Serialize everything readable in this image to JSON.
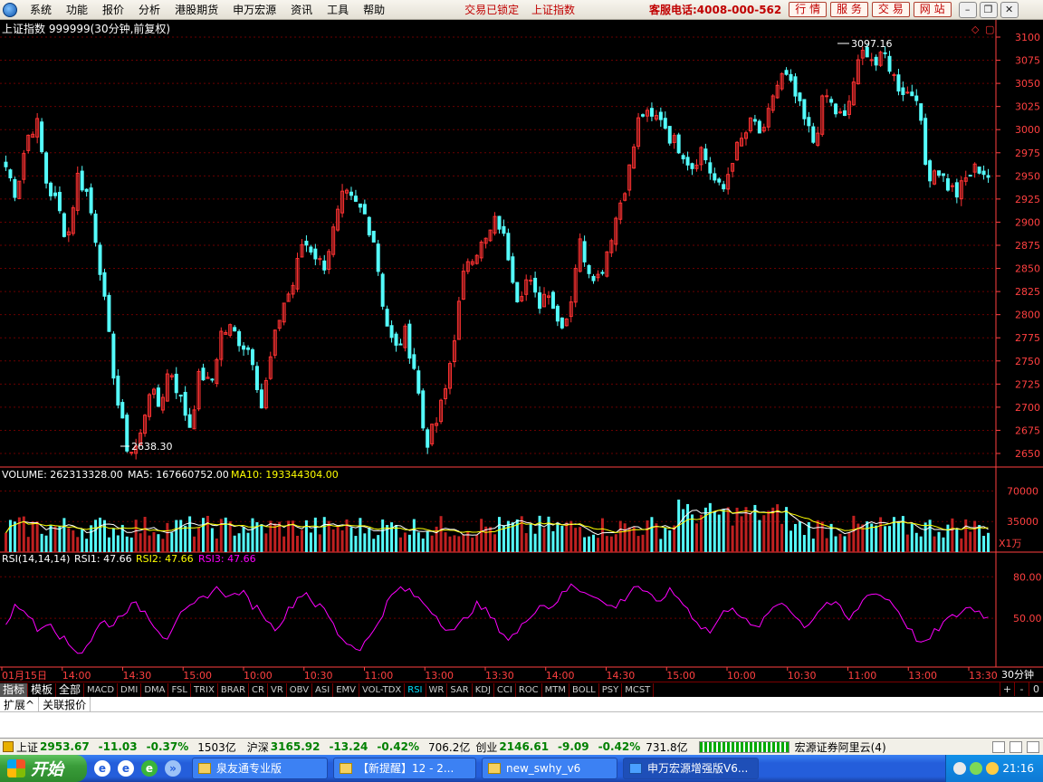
{
  "menu": {
    "items": [
      "系统",
      "功能",
      "报价",
      "分析",
      "港股期货",
      "申万宏源",
      "资讯",
      "工具",
      "帮助"
    ],
    "status": [
      "交易已锁定",
      "上证指数"
    ],
    "hotline": "客服电话:4008-000-562",
    "buttons": [
      "行 情",
      "服 务",
      "交 易",
      "网 站"
    ]
  },
  "chart": {
    "title": "上证指数 999999(30分钟,前复权)",
    "high_label": "3097.16",
    "low_label": "2638.30",
    "price_ticks": [
      "3100",
      "3075",
      "3050",
      "3025",
      "3000",
      "2975",
      "2950",
      "2925",
      "2900",
      "2875",
      "2850",
      "2825",
      "2800",
      "2775",
      "2750",
      "2725",
      "2700",
      "2675",
      "2650"
    ],
    "volume_header": {
      "volume": "VOLUME: 262313328.00",
      "ma5": "MA5: 167660752.00",
      "ma10": "MA10: 193344304.00"
    },
    "volume_ticks": [
      "70000",
      "35000"
    ],
    "volume_unit": "X1万",
    "rsi_header": {
      "label": "RSI(14,14,14)",
      "rsi1": "RSI1: 47.66",
      "rsi2": "RSI2: 47.66",
      "rsi3": "RSI3: 47.66"
    },
    "rsi_ticks": [
      "80.00",
      "50.00"
    ],
    "time_labels": [
      "01月15日",
      "14:00",
      "14:30",
      "15:00",
      "10:00",
      "10:30",
      "11:00",
      "13:00",
      "13:30",
      "14:00",
      "14:30",
      "15:00",
      "10:00",
      "10:30",
      "11:00",
      "13:00",
      "13:30"
    ],
    "period": "30分钟",
    "colors": {
      "up": "#ff3232",
      "down": "#54fcfc",
      "ma5": "#ffffff",
      "ma10": "#ffff00",
      "rsi": "#ff00ff",
      "axis": "#ff4040",
      "grid": "#6a0000"
    }
  },
  "chart_data": {
    "type": "candlestick",
    "title": "上证指数 999999(30分钟,前复权)",
    "high": 3097.16,
    "low": 2638.3,
    "ylim": [
      2630,
      3110
    ],
    "rsi_last": 47.66,
    "rsi_ylim": [
      20,
      90
    ],
    "volume_ylim": [
      0,
      85000
    ],
    "volume_unit": "X1万",
    "close_path": [
      2960,
      2930,
      2990,
      3010,
      2940,
      2920,
      2880,
      2950,
      2930,
      2870,
      2780,
      2700,
      2650,
      2660,
      2720,
      2700,
      2745,
      2710,
      2680,
      2740,
      2720,
      2780,
      2785,
      2770,
      2760,
      2700,
      2760,
      2810,
      2830,
      2880,
      2870,
      2850,
      2890,
      2930,
      2920,
      2910,
      2880,
      2800,
      2760,
      2780,
      2740,
      2660,
      2680,
      2720,
      2790,
      2860,
      2870,
      2880,
      2905,
      2870,
      2820,
      2840,
      2810,
      2830,
      2790,
      2800,
      2880,
      2850,
      2840,
      2880,
      2920,
      2960,
      3020,
      3010,
      3015,
      2990,
      2980,
      2960,
      2980,
      2950,
      2930,
      2970,
      2990,
      3010,
      2990,
      3040,
      3060,
      3040,
      3010,
      2985,
      3040,
      3020,
      3010,
      3060,
      3090,
      3070,
      3080,
      3050,
      3040,
      3040,
      2950,
      2960,
      2940,
      2930,
      2950,
      2960,
      2950
    ],
    "volume_baseline": 30000,
    "rsi_path": [
      45,
      60,
      55,
      40,
      50,
      38,
      30,
      25,
      35,
      48,
      45,
      55,
      60,
      55,
      45,
      35,
      50,
      55,
      62,
      68,
      72,
      65,
      70,
      60,
      55,
      42,
      50,
      62,
      70,
      60,
      55,
      40,
      32,
      28,
      35,
      50,
      65,
      72,
      68,
      62,
      55,
      45,
      40,
      50,
      60,
      55,
      45,
      35,
      40,
      52,
      60,
      58,
      66,
      74,
      70,
      68,
      60,
      58,
      65,
      75,
      68,
      60,
      70,
      65,
      55,
      45,
      40,
      52,
      60,
      50,
      42,
      48,
      60,
      62,
      50,
      44,
      55,
      62,
      58,
      48,
      60,
      70,
      66,
      62,
      50,
      38,
      30,
      40,
      48,
      52,
      58,
      56,
      50
    ]
  },
  "tabs": {
    "categories": [
      "指标",
      "模板",
      "全部"
    ],
    "indicators": [
      "MACD",
      "DMI",
      "DMA",
      "FSL",
      "TRIX",
      "BRAR",
      "CR",
      "VR",
      "OBV",
      "ASI",
      "EMV",
      "VOL-TDX",
      "RSI",
      "WR",
      "SAR",
      "KDJ",
      "CCI",
      "ROC",
      "MTM",
      "BOLL",
      "PSY",
      "MCST"
    ],
    "controls": [
      "+",
      "-",
      "0"
    ]
  },
  "ext_tabs": [
    "扩展^",
    "关联报价"
  ],
  "status": {
    "sh_label": "上证",
    "sh_price": "2953.67",
    "sh_chg": "-11.03",
    "sh_pct": "-0.37%",
    "sh_amt": "1503亿",
    "hs_label": "沪深",
    "hs_price": "3165.92",
    "hs_chg": "-13.24",
    "hs_pct": "-0.42%",
    "hs_amt": "706.2亿",
    "cy_label": "创业",
    "cy_price": "2146.61",
    "cy_chg": "-9.09",
    "cy_pct": "-0.42%",
    "cy_amt": "731.8亿",
    "broker": "宏源证券阿里云(4)"
  },
  "taskbar": {
    "start": "开始",
    "tasks": [
      "泉友通专业版",
      "【新提醒】12 - 2...",
      "new_swhy_v6",
      "申万宏源增强版V6..."
    ],
    "clock": "21:16"
  }
}
